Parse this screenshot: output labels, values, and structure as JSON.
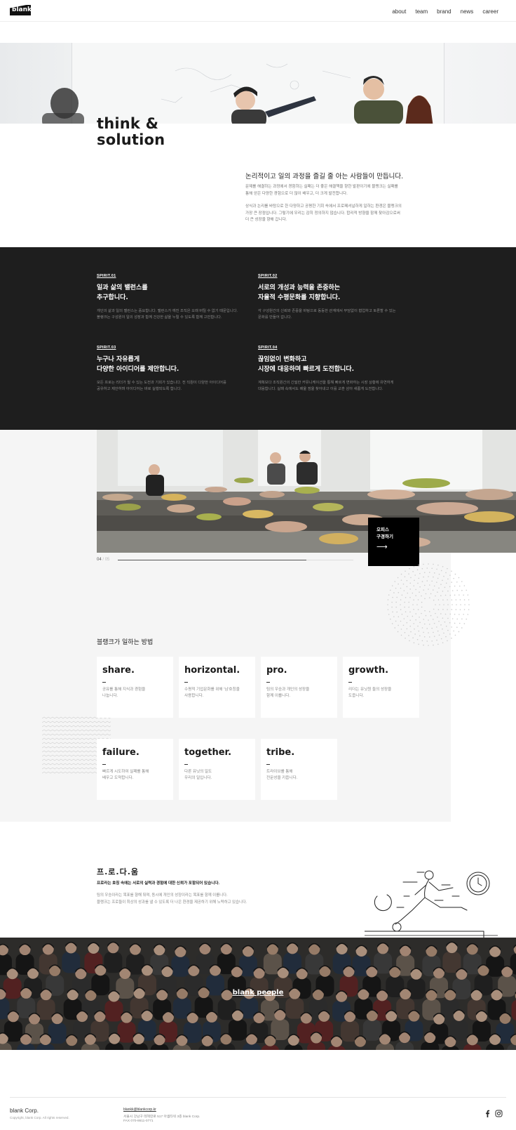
{
  "header": {
    "logo": "blank.",
    "nav": [
      "about",
      "team",
      "brand",
      "news",
      "career"
    ]
  },
  "hero": {
    "title_line1": "think &",
    "title_line2": "solution",
    "intro_heading": "논리적이고 일의 과정을 즐길 줄 아는 사람들이 만듭니다.",
    "intro_p1_line1": "문제를 해결하는 과정에서 경험하는 실패는 더 좋은 해결책을 향한 발판이기에 블랭크는 실패를",
    "intro_p1_line2": "통해 얻은 다양한 경험으로 더 많이 배우고, 더 크게 발전합니다.",
    "intro_p2_line1": "상식과 논리를 바탕으로 한 다양하고 공평한 기회 속에서 프로페셔널하게 일하는 환경은 블랭크의",
    "intro_p2_line2": "가장 큰 장점입니다. 그렇기에 우리는 감히 정의하지 않습니다. 합리적 방향을 함께 찾아감으로써",
    "intro_p2_line3": "더 큰 성장을 향해 갑니다."
  },
  "spirits": [
    {
      "tag": "SPIRIT.01",
      "title": "일과 삶의 밸런스를\n추구합니다.",
      "desc": "개인의 삶과 일의 밸런스는 중요합니다. 밸런스가 깨진 조직은 오래 버틸 수 없기 때문입니다.\n블랭크는 구성원이 일의 성장과 함께 건강한 삶을 누릴 수 있도록 함께 고민합니다."
    },
    {
      "tag": "SPIRIT.02",
      "title": "서로의 개성과 능력을 존중하는\n자율적 수평문화를 지향합니다.",
      "desc": "각 구성원간의 신뢰와 존중을 바탕으로 동등한 관계에서 부담없이 협업하고 토론할 수 있는\n문화를 만들어 갑니다."
    },
    {
      "tag": "SPIRIT.03",
      "title": "누구나 자유롭게\n다양한 아이디어를 제안합니다.",
      "desc": "모든 프로는 리더가 될 수 있는 도전과 기회가 있습니다. 전 직원이 다양한 아이디어를\n공유하고 제안하며 아이디어는 바로 실행되도록 합니다."
    },
    {
      "tag": "SPIRIT.04",
      "title": "끊임없이 변화하고\n시장에 대응하며 빠르게 도전합니다.",
      "desc": "계획보다 조직원간의 긴밀한 커뮤니케이션을 통해 빠르게 변화하는 시장 상황에 유연하게\n대응합니다. 실패 속에서도 배울 점을 찾아내고 이를 교훈 삼아 새롭게 도전합니다."
    }
  ],
  "office": {
    "tour_label": "오피스\n구경하기",
    "tour_arrow": "⟶",
    "current": "04",
    "separator": " / ",
    "total": "05",
    "progress": 0.8
  },
  "ways": {
    "title": "블랭크가 일하는 방법",
    "cards": [
      {
        "keyword": "share.",
        "desc": "공유를 통해 지식과 경험을\n나눕니다."
      },
      {
        "keyword": "horizontal.",
        "desc": "수평적 기업문화를 위해 '님'호칭을\n사용합니다."
      },
      {
        "keyword": "pro.",
        "desc": "팀의 우승과 개인의 성장을\n함께 이룹니다."
      },
      {
        "keyword": "growth.",
        "desc": "리더는 유닛원 들의 성장을\n도웁니다."
      },
      {
        "keyword": "failure.",
        "desc": "빠르게 시도하여 실패를 통해\n배우고 도약합니다."
      },
      {
        "keyword": "together.",
        "desc": "다른 유닛의 일도\n우리의 일입니다."
      },
      {
        "keyword": "tribe.",
        "desc": "트라이브를 통해\n전문성을 키웁니다."
      }
    ]
  },
  "prodaum": {
    "title": "프.로.다.움",
    "subtitle": "프로라는 호칭 속에는 서로의 실력과 경험에 대한 신뢰가 포함되어 있습니다.",
    "text": "팀의 우승이라는 목표를 향해 뛰며, 동시에 개인의 성장이라는 목표를 함께 이룹니다.\n블랭크는 프로들이 최상의 성과를 낼 수 있도록 더 나은 환경을 제공하기 위해 노력하고 있습니다."
  },
  "people": {
    "label": "blank people"
  },
  "footer": {
    "brand": "blank Corp.",
    "copyright": "Copyright, blank Corp. All rights reserved.",
    "email": "blankk@blankcorp.kr",
    "address": "서울시 강남구 테헤란로 517 아셈타워 3층 blank Corp.",
    "fax": "FAX 070-8611-0771",
    "social": [
      "facebook-icon",
      "instagram-icon"
    ]
  }
}
